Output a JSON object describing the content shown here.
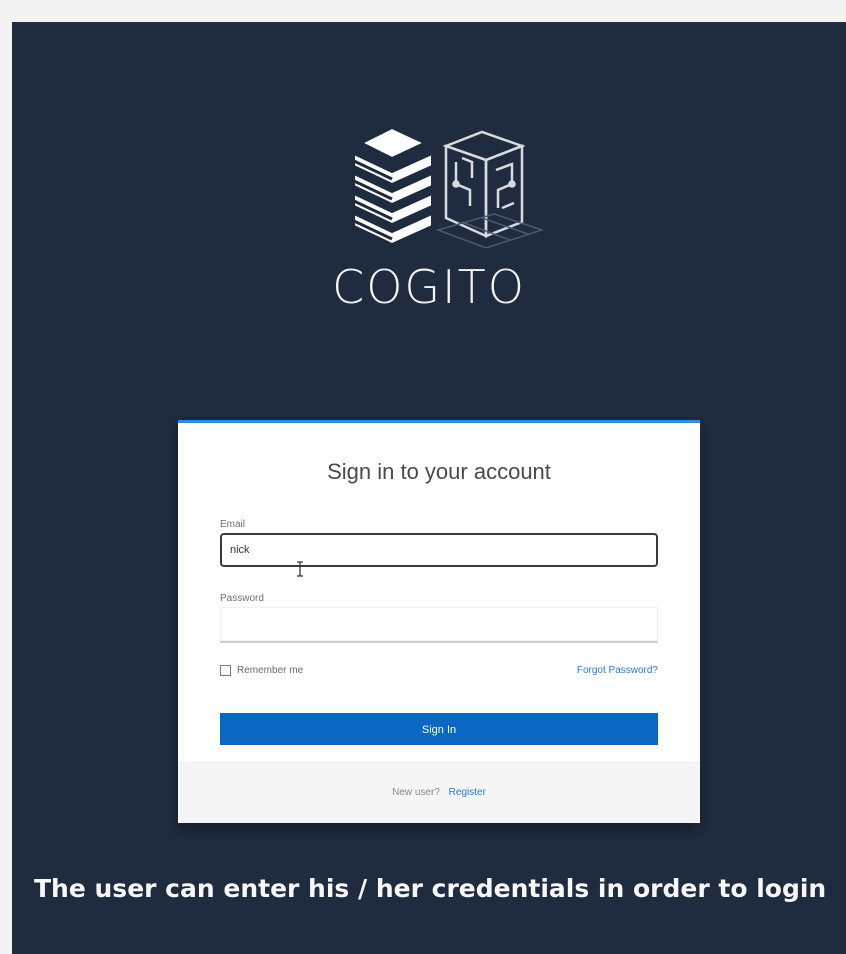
{
  "brand": {
    "name": "COGITO"
  },
  "login": {
    "title": "Sign in to your account",
    "email_label": "Email",
    "email_value": "nick",
    "password_label": "Password",
    "password_value": "",
    "remember_label": "Remember me",
    "forgot_label": "Forgot Password?",
    "signin_label": "Sign In",
    "new_user_label": "New user?",
    "register_label": "Register"
  },
  "caption": {
    "text": "The user can enter his / her credentials in order to login"
  },
  "colors": {
    "background": "#1f2b3e",
    "accent": "#0b67c2",
    "link": "#2b78c6"
  },
  "icons": {
    "logo": "stacked-server-and-cube-logo",
    "cursor": "i-beam-cursor-icon"
  }
}
